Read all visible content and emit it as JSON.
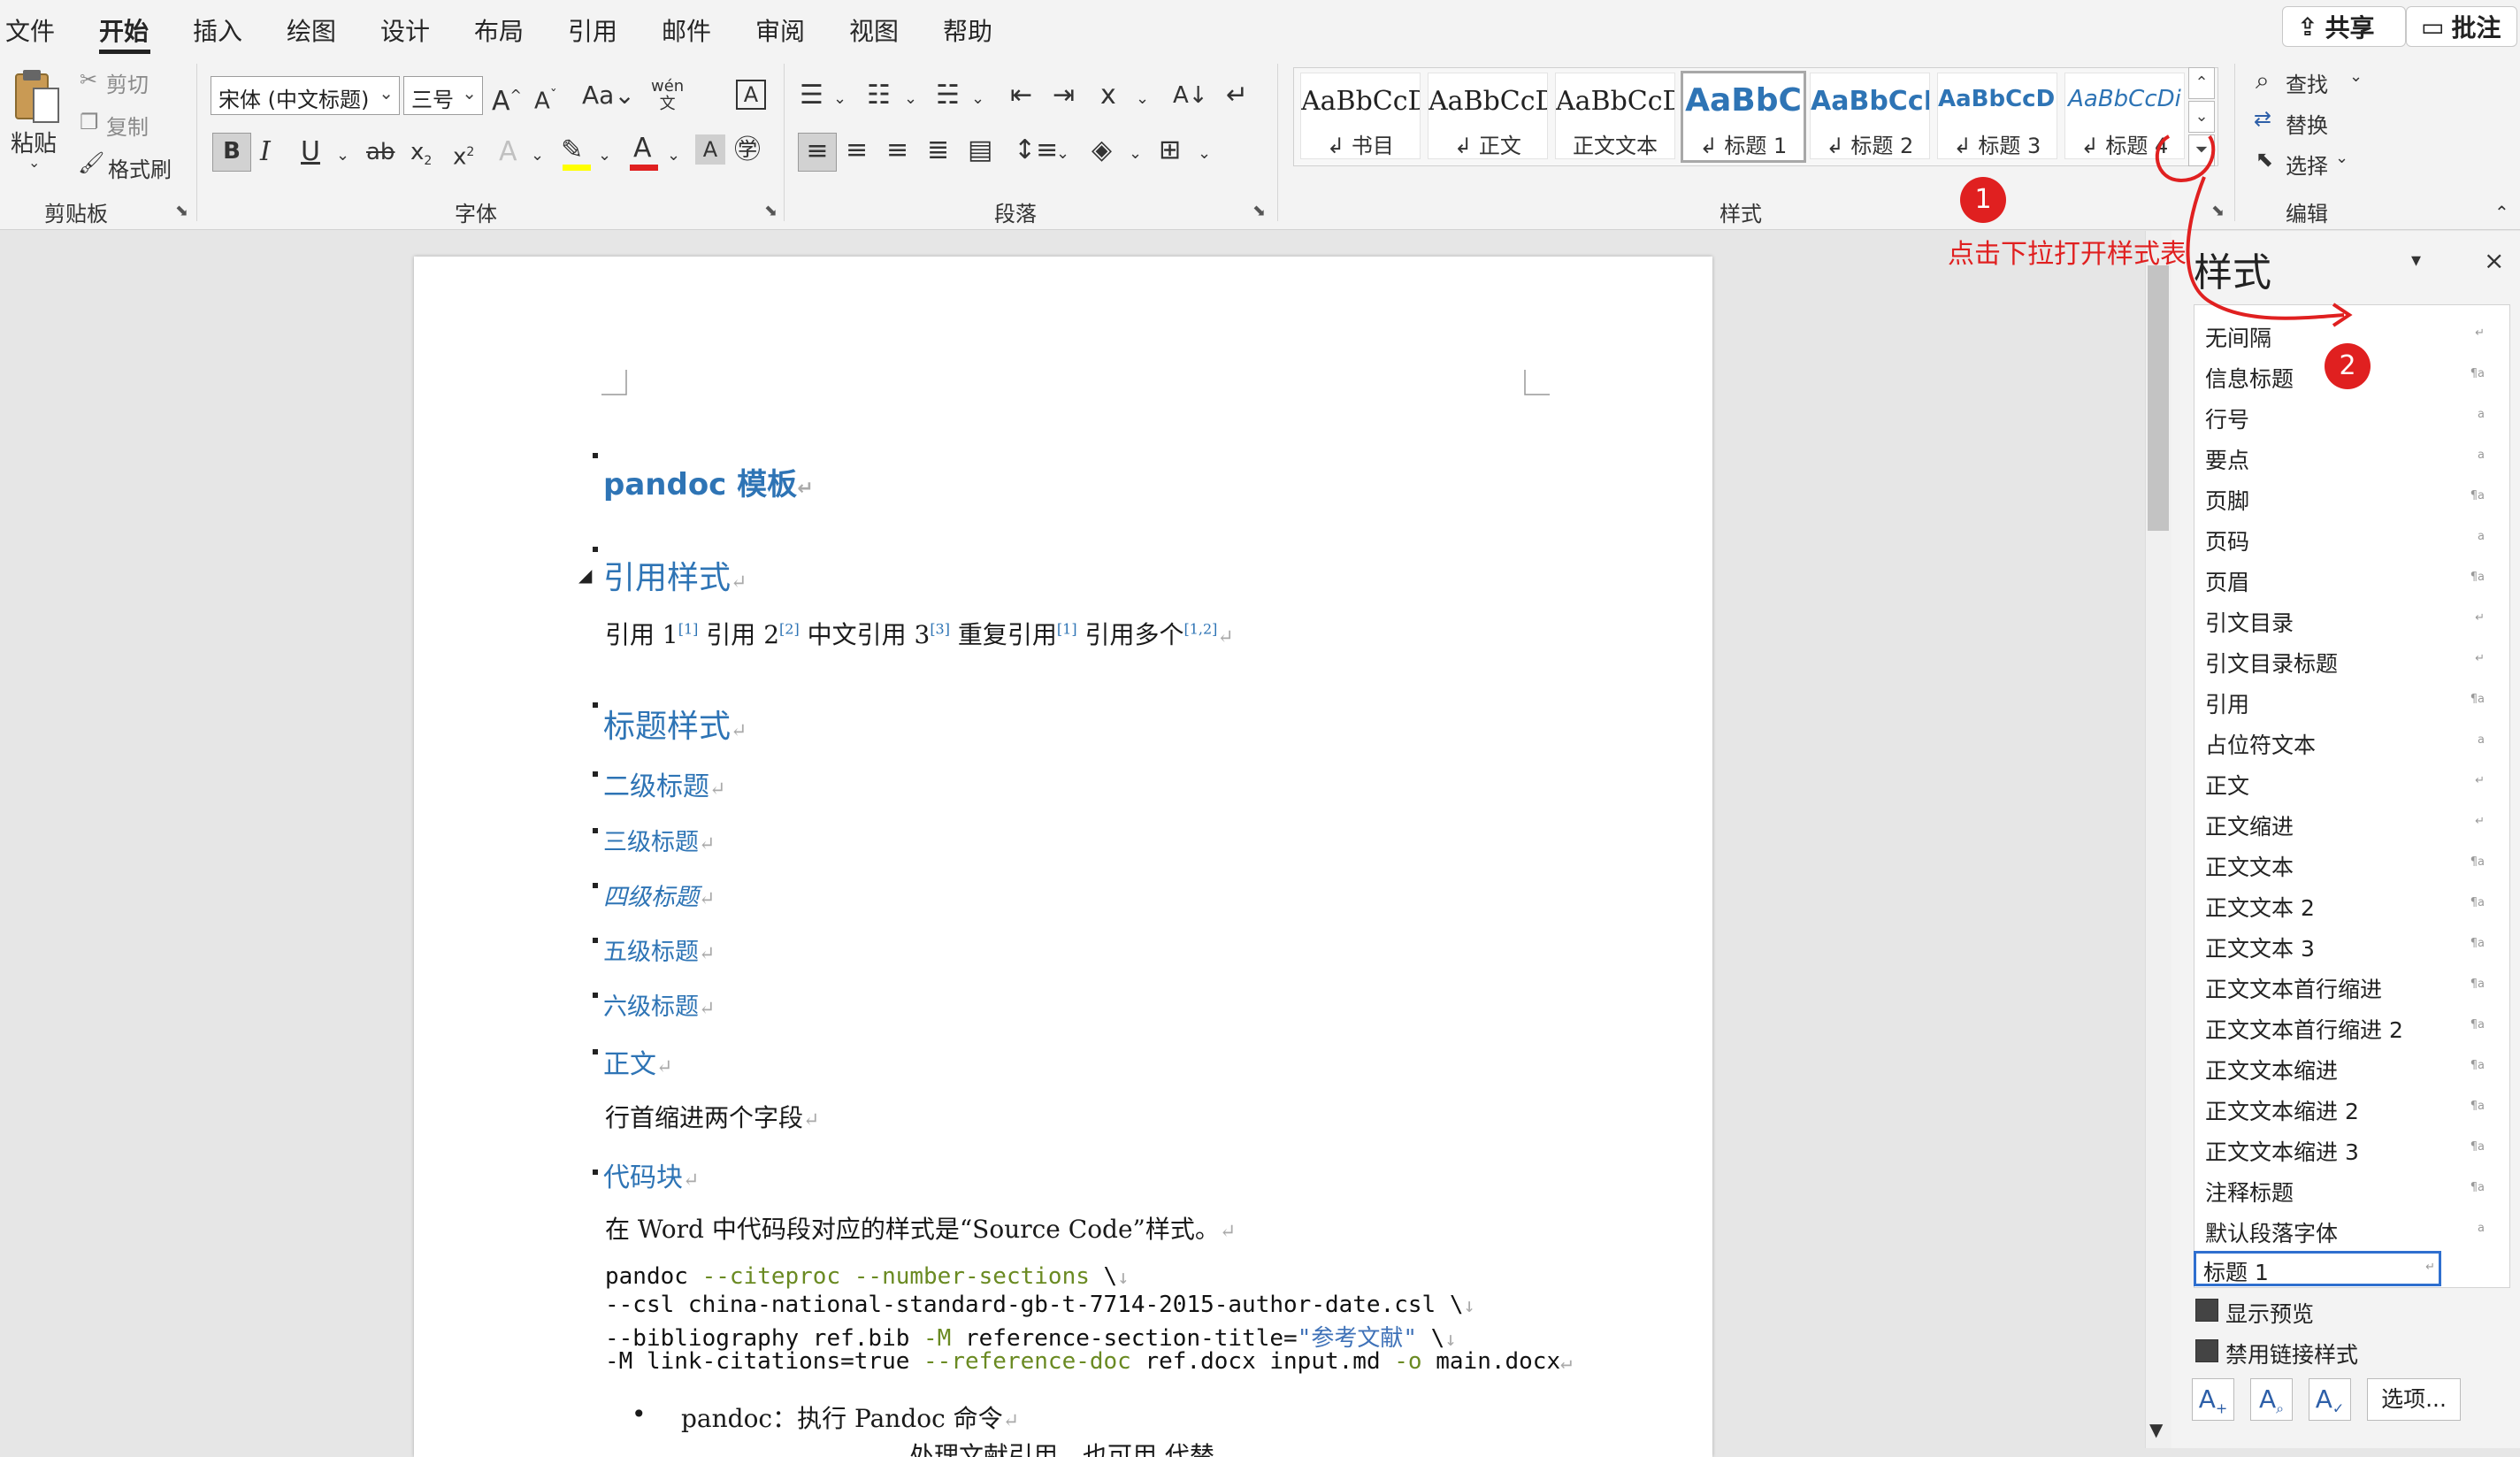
{
  "tabs": {
    "file": "文件",
    "home": "开始",
    "insert": "插入",
    "draw": "绘图",
    "design": "设计",
    "layout": "布局",
    "references": "引用",
    "mailings": "邮件",
    "review": "审阅",
    "view": "视图",
    "help": "帮助"
  },
  "topright": {
    "share": "共享",
    "comment": "批注"
  },
  "clipboard": {
    "paste": "粘贴",
    "cut": "剪切",
    "copy": "复制",
    "format_painter": "格式刷",
    "label": "剪贴板"
  },
  "font": {
    "name": "宋体 (中文标题)",
    "size": "三号",
    "label": "字体"
  },
  "paragraph": {
    "label": "段落"
  },
  "styles_gallery": {
    "label": "样式",
    "tiles": [
      {
        "sample": "AaBbCcD",
        "name": "↲ 书目"
      },
      {
        "sample": "AaBbCcD",
        "name": "↲ 正文"
      },
      {
        "sample": "AaBbCcD",
        "name": "正文文本"
      },
      {
        "sample": "AaBbC",
        "name": "↲ 标题 1"
      },
      {
        "sample": "AaBbCcI",
        "name": "↲ 标题 2"
      },
      {
        "sample": "AaBbCcDi",
        "name": "↲ 标题 3"
      },
      {
        "sample": "AaBbCcDi",
        "name": "↲ 标题 4"
      }
    ]
  },
  "editing": {
    "find": "查找",
    "replace": "替换",
    "select": "选择",
    "label": "编辑"
  },
  "annotations": {
    "one": "1",
    "two": "2",
    "text": "点击下拉打开样式表"
  },
  "doc": {
    "title": "pandoc 模板",
    "h_cite": "引用样式",
    "cite_line": {
      "a": "引用 1",
      "s1": "[1]",
      "b": " 引用 2",
      "s2": "[2]",
      "c": " 中文引用 3",
      "s3": "[3]",
      "d": " 重复引用",
      "s4": "[1]",
      "e": " 引用多个",
      "s5": "[1,2]"
    },
    "h_heading": "标题样式",
    "h2": "二级标题",
    "h3": "三级标题",
    "h4": "四级标题",
    "h5": "五级标题",
    "h6": "六级标题",
    "h_body": "正文",
    "body_line": "行首缩进两个字段",
    "h_code": "代码块",
    "code_intro": "在 Word 中代码段对应的样式是“Source Code”样式。",
    "code": {
      "l1a": "pandoc ",
      "l1b": "--citeproc --number-sections",
      "l1c": " \\",
      "l2": "--csl china-national-standard-gb-t-7714-2015-author-date.csl \\",
      "l3a": "--bibliography ref.bib ",
      "l3b": "-M",
      "l3c": " reference-section-title=",
      "l3d": "\"参考文献\"",
      "l3e": " \\",
      "l4a": "-M link-citations=true ",
      "l4b": "--reference-doc",
      "l4c": " ref.docx input.md ",
      "l4d": "-o",
      "l4e": " main.docx"
    },
    "bullet1": "pandoc：执行 Pandoc 命令",
    "bullet2": "处理文献引用，也可用 代替"
  },
  "styles_pane": {
    "title": "样式",
    "items": [
      "无间隔",
      "信息标题",
      "行号",
      "要点",
      "页脚",
      "页码",
      "页眉",
      "引文目录",
      "引文目录标题",
      "引用",
      "占位符文本",
      "正文",
      "正文缩进",
      "正文文本",
      "正文文本 2",
      "正文文本 3",
      "正文文本首行缩进",
      "正文文本首行缩进 2",
      "正文文本缩进",
      "正文文本缩进 2",
      "正文文本缩进 3",
      "注释标题",
      "默认段落字体",
      "标题 1"
    ],
    "show_preview": "显示预览",
    "disable_linked": "禁用链接样式",
    "options": "选项..."
  }
}
